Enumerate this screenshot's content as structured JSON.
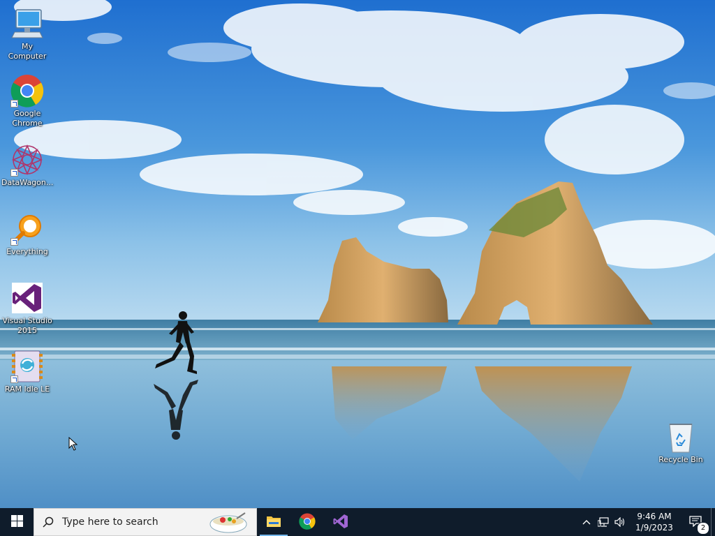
{
  "desktop": {
    "icons": [
      {
        "label": "My Computer",
        "icon": "computer-icon",
        "shortcut": false
      },
      {
        "label": "Google Chrome",
        "icon": "chrome-icon",
        "shortcut": true
      },
      {
        "label": "DataWagon...",
        "icon": "datawagon-icon",
        "shortcut": true
      },
      {
        "label": "Everything",
        "icon": "everything-icon",
        "shortcut": true
      },
      {
        "label": "Visual Studio 2015",
        "icon": "visual-studio-icon",
        "shortcut": false
      },
      {
        "label": "RAM Idle LE",
        "icon": "ram-idle-icon",
        "shortcut": true
      },
      {
        "label": "Recycle Bin",
        "icon": "recycle-bin-icon",
        "shortcut": false
      }
    ]
  },
  "taskbar": {
    "start_icon": "windows-logo-icon",
    "search": {
      "placeholder": "Type here to search",
      "icon": "search-icon",
      "highlight_icon": "search-highlight-icon"
    },
    "pinned": [
      {
        "name": "File Explorer",
        "icon": "folder-icon",
        "active": true
      },
      {
        "name": "Google Chrome",
        "icon": "chrome-icon",
        "active": false
      },
      {
        "name": "Visual Studio",
        "icon": "visual-studio-icon",
        "active": false
      }
    ],
    "tray": {
      "icons": [
        "chevron-up-icon",
        "network-icon",
        "volume-icon"
      ],
      "time": "9:46 AM",
      "date": "1/9/2023",
      "notification_count": "2"
    }
  },
  "colors": {
    "taskbar": "#0f1c2b",
    "accent": "#76b9ed",
    "sky": "#2f7fd0",
    "sand": "#9cc7e2"
  }
}
